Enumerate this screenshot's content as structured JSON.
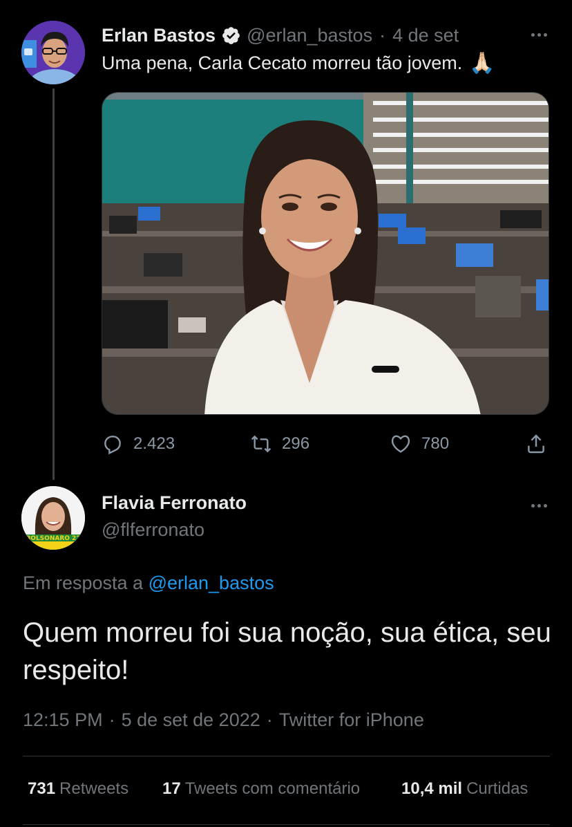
{
  "tweet1": {
    "author_name": "Erlan Bastos",
    "handle": "@erlan_bastos",
    "separator": "·",
    "date": "4 de set",
    "text": "Uma pena, Carla Cecato morreu tão jovem.",
    "emoji": "🙏🏻",
    "verified": true,
    "actions": {
      "replies": "2.423",
      "retweets": "296",
      "likes": "780"
    }
  },
  "tweet2": {
    "author_name": "Flavia Ferronato",
    "handle": "@flferronato",
    "avatar_badge": "BOLSONARO 22",
    "reply_prefix": "Em resposta a",
    "reply_mention": "@erlan_bastos",
    "text": "Quem morreu foi sua noção, sua ética, seu respeito!",
    "time": "12:15 PM",
    "date": "5 de set de 2022",
    "source": "Twitter for iPhone",
    "separator": "·",
    "stats": {
      "retweets_count": "731",
      "retweets_label": "Retweets",
      "quotes_count": "17",
      "quotes_label": "Tweets com comentário",
      "likes_count": "10,4 mil",
      "likes_label": "Curtidas"
    }
  },
  "colors": {
    "background": "#000000",
    "text_primary": "#e7e9ea",
    "text_secondary": "#71767b",
    "accent": "#1d9bf0"
  }
}
